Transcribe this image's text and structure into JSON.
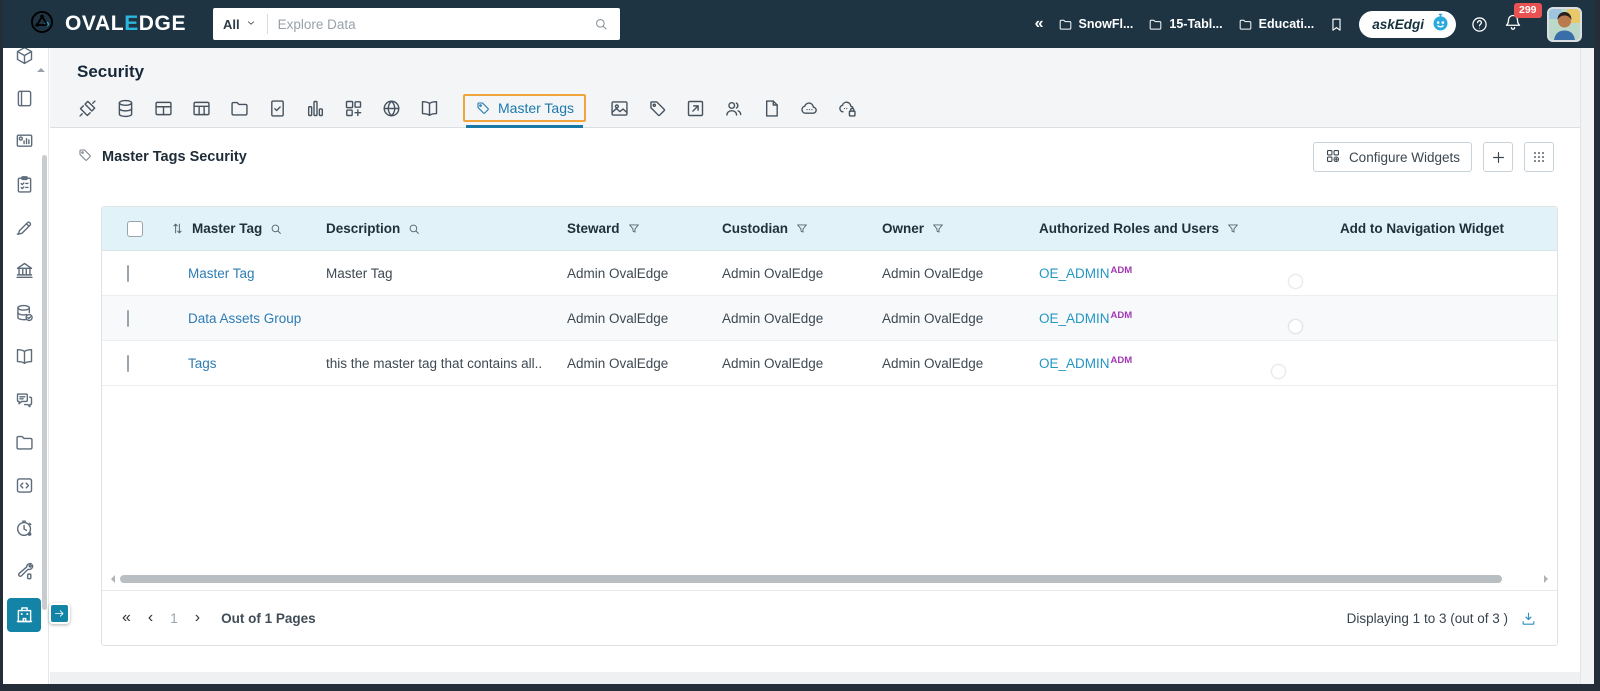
{
  "colors": {
    "navbar_bg": "#1e3443",
    "accent_teal": "#1484a6",
    "link_blue": "#2e7cb4",
    "authorized_link": "#2496c4",
    "authorized_badge_purple": "#a238b6",
    "active_tab_outline_orange": "#f0a43c",
    "active_tab_underline": "#1779a8",
    "badge_red": "#e85252",
    "table_header_bg": "#e1f3f8",
    "toggle_on": "#1180a3"
  },
  "navbar": {
    "logo": {
      "part1": "OVAL",
      "part2": "E",
      "part3": "DGE"
    },
    "search": {
      "scope": "All",
      "placeholder": "Explore Data"
    },
    "breadcrumbs": [
      {
        "label": "SnowFl..."
      },
      {
        "label": "15-Tabl..."
      },
      {
        "label": "Educati..."
      }
    ],
    "ask_edgi_label": "askEdgi",
    "notification_count": "299"
  },
  "sidebar": {
    "items": [
      {
        "icon": "cube",
        "name": "catalog"
      },
      {
        "icon": "notebook",
        "name": "notebook"
      },
      {
        "icon": "monitor-chart",
        "name": "reports"
      },
      {
        "icon": "clipboard",
        "name": "projects"
      },
      {
        "icon": "hand-pen",
        "name": "data-literacy"
      },
      {
        "icon": "bank",
        "name": "governance"
      },
      {
        "icon": "database-check",
        "name": "data-quality"
      },
      {
        "icon": "open-book",
        "name": "business-glossary"
      },
      {
        "icon": "chat",
        "name": "collaboration"
      },
      {
        "icon": "folder",
        "name": "files"
      },
      {
        "icon": "code",
        "name": "query-sheet"
      },
      {
        "icon": "clock",
        "name": "jobs"
      },
      {
        "icon": "tools",
        "name": "advanced-tools"
      },
      {
        "icon": "building",
        "name": "security",
        "active": true
      }
    ]
  },
  "page": {
    "title": "Security",
    "tabs": [
      {
        "icon": "plug",
        "name": "connectors"
      },
      {
        "icon": "database",
        "name": "schemas"
      },
      {
        "icon": "table",
        "name": "tables"
      },
      {
        "icon": "table-cols",
        "name": "table-columns"
      },
      {
        "icon": "folder",
        "name": "files"
      },
      {
        "icon": "file-check",
        "name": "file-columns"
      },
      {
        "icon": "bar-chart",
        "name": "reports"
      },
      {
        "icon": "blocks",
        "name": "report-columns"
      },
      {
        "icon": "globe",
        "name": "domains"
      },
      {
        "icon": "open-book",
        "name": "terms"
      },
      {
        "icon": "tag",
        "name": "master-tags",
        "label": "Master Tags",
        "active": true
      },
      {
        "icon": "image",
        "name": "stories"
      },
      {
        "icon": "tag",
        "name": "tags"
      },
      {
        "icon": "checkbox-arrow",
        "name": "service-requests"
      },
      {
        "icon": "people",
        "name": "users-roles"
      },
      {
        "icon": "file",
        "name": "documents"
      },
      {
        "icon": "cloud-api",
        "name": "apis"
      },
      {
        "icon": "cloud-api-lock",
        "name": "api-security"
      }
    ],
    "section_title": "Master Tags Security",
    "configure_widgets_label": "Configure Widgets"
  },
  "table": {
    "columns": [
      {
        "label": "Master Tag",
        "controls": [
          "sort",
          "search"
        ]
      },
      {
        "label": "Description",
        "controls": [
          "search"
        ]
      },
      {
        "label": "Steward",
        "controls": [
          "filter"
        ]
      },
      {
        "label": "Custodian",
        "controls": [
          "filter"
        ]
      },
      {
        "label": "Owner",
        "controls": [
          "filter"
        ]
      },
      {
        "label": "Authorized Roles and Users",
        "controls": [
          "filter"
        ]
      },
      {
        "label": "Add to Navigation Widget",
        "controls": []
      }
    ],
    "rows": [
      {
        "master_tag": "Master Tag",
        "description": "Master Tag",
        "steward": "Admin OvalEdge",
        "custodian": "Admin OvalEdge",
        "owner": "Admin OvalEdge",
        "authorized": "OE_ADMIN",
        "authorized_badge": "ADM",
        "add_to_nav": false
      },
      {
        "master_tag": "Data Assets Group",
        "description": "",
        "steward": "Admin OvalEdge",
        "custodian": "Admin OvalEdge",
        "owner": "Admin OvalEdge",
        "authorized": "OE_ADMIN",
        "authorized_badge": "ADM",
        "add_to_nav": false
      },
      {
        "master_tag": "Tags",
        "description": "this the master tag that contains all...",
        "steward": "Admin OvalEdge",
        "custodian": "Admin OvalEdge",
        "owner": "Admin OvalEdge",
        "authorized": "OE_ADMIN",
        "authorized_badge": "ADM",
        "add_to_nav": true
      }
    ]
  },
  "pagination": {
    "first": "«",
    "prev": "‹",
    "page": "1",
    "next": "›",
    "pages_label": "Out of 1 Pages",
    "displaying": "Displaying 1 to 3  (out of 3 )"
  }
}
